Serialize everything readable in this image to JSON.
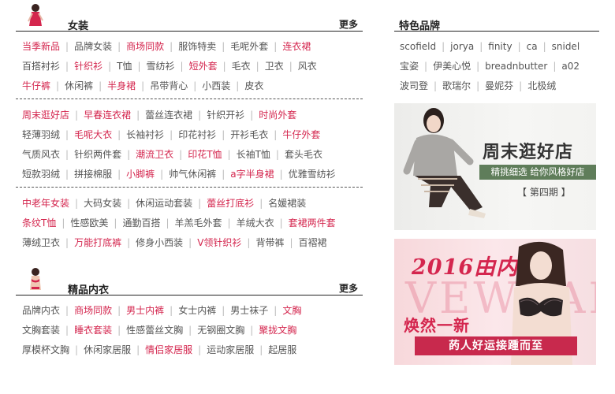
{
  "colors": {
    "accent": "#d4264e",
    "text": "#555555",
    "banner_green": "#5f7d5a"
  },
  "women": {
    "title": "女装",
    "more": "更多",
    "groups": [
      [
        [
          [
            "当季新品",
            true
          ],
          [
            "品牌女装",
            false
          ],
          [
            "商场同款",
            true
          ],
          [
            "服饰特卖",
            false
          ],
          [
            "毛呢外套",
            false
          ],
          [
            "连衣裙",
            true
          ]
        ],
        [
          [
            "百搭衬衫",
            false
          ],
          [
            "针织衫",
            true
          ],
          [
            "T恤",
            false
          ],
          [
            "雪纺衫",
            false
          ],
          [
            "短外套",
            true
          ],
          [
            "毛衣",
            false
          ],
          [
            "卫衣",
            false
          ],
          [
            "风衣",
            false
          ]
        ],
        [
          [
            "牛仔裤",
            true
          ],
          [
            "休闲裤",
            false
          ],
          [
            "半身裙",
            true
          ],
          [
            "吊带背心",
            false
          ],
          [
            "小西装",
            false
          ],
          [
            "皮衣",
            false
          ]
        ]
      ],
      [
        [
          [
            "周末逛好店",
            true
          ],
          [
            "早春连衣裙",
            true
          ],
          [
            "蕾丝连衣裙",
            false
          ],
          [
            "针织开衫",
            false
          ],
          [
            "时尚外套",
            true
          ]
        ],
        [
          [
            "轻薄羽绒",
            false
          ],
          [
            "毛呢大衣",
            true
          ],
          [
            "长袖衬衫",
            false
          ],
          [
            "印花衬衫",
            false
          ],
          [
            "开衫毛衣",
            false
          ],
          [
            "牛仔外套",
            true
          ]
        ],
        [
          [
            "气质风衣",
            false
          ],
          [
            "针织两件套",
            false
          ],
          [
            "潮流卫衣",
            true
          ],
          [
            "印花T恤",
            true
          ],
          [
            "长袖T恤",
            false
          ],
          [
            "套头毛衣",
            false
          ]
        ],
        [
          [
            "短款羽绒",
            false
          ],
          [
            "拼接棉服",
            false
          ],
          [
            "小脚裤",
            true
          ],
          [
            "帅气休闲裤",
            false
          ],
          [
            "a字半身裙",
            true
          ],
          [
            "优雅雪纺衫",
            false
          ]
        ]
      ],
      [
        [
          [
            "中老年女装",
            true
          ],
          [
            "大码女装",
            false
          ],
          [
            "休闲运动套装",
            false
          ],
          [
            "蕾丝打底衫",
            true
          ],
          [
            "名媛裙装",
            false
          ]
        ],
        [
          [
            "条纹T恤",
            true
          ],
          [
            "性感欧美",
            false
          ],
          [
            "通勤百搭",
            false
          ],
          [
            "羊羔毛外套",
            false
          ],
          [
            "羊绒大衣",
            false
          ],
          [
            "套裙两件套",
            true
          ]
        ],
        [
          [
            "薄绒卫衣",
            false
          ],
          [
            "万能打底裤",
            true
          ],
          [
            "修身小西装",
            false
          ],
          [
            "V领针织衫",
            true
          ],
          [
            "背带裤",
            false
          ],
          [
            "百褶裙",
            false
          ]
        ]
      ]
    ]
  },
  "underwear": {
    "title": "精品内衣",
    "more": "更多",
    "groups": [
      [
        [
          [
            "品牌内衣",
            false
          ],
          [
            "商场同款",
            true
          ],
          [
            "男士内裤",
            true
          ],
          [
            "女士内裤",
            false
          ],
          [
            "男士袜子",
            false
          ],
          [
            "文胸",
            true
          ]
        ],
        [
          [
            "文胸套装",
            false
          ],
          [
            "睡衣套装",
            true
          ],
          [
            "性感蕾丝文胸",
            false
          ],
          [
            "无钢圈文胸",
            false
          ],
          [
            "聚拢文胸",
            true
          ]
        ],
        [
          [
            "厚模杯文胸",
            false
          ],
          [
            "休闲家居服",
            false
          ],
          [
            "情侣家居服",
            true
          ],
          [
            "运动家居服",
            false
          ],
          [
            "起居服",
            false
          ]
        ]
      ]
    ]
  },
  "brands": {
    "title": "特色品牌",
    "rows": [
      [
        "scofield",
        "jorya",
        "finity",
        "ca",
        "snidel"
      ],
      [
        "宝姿",
        "伊美心悦",
        "breadnbutter",
        "a02"
      ],
      [
        "波司登",
        "歌瑞尔",
        "曼妮芬",
        "北极绒"
      ]
    ]
  },
  "banner1": {
    "title": "周末逛好店",
    "subtitle": "精挑细选 给你风格好店",
    "issue": "【 第四期 】"
  },
  "banner2": {
    "year": "2016由内而外",
    "big": "VEWEAR",
    "title": "焕然一新",
    "strip": "菂人好运接踵而至"
  }
}
